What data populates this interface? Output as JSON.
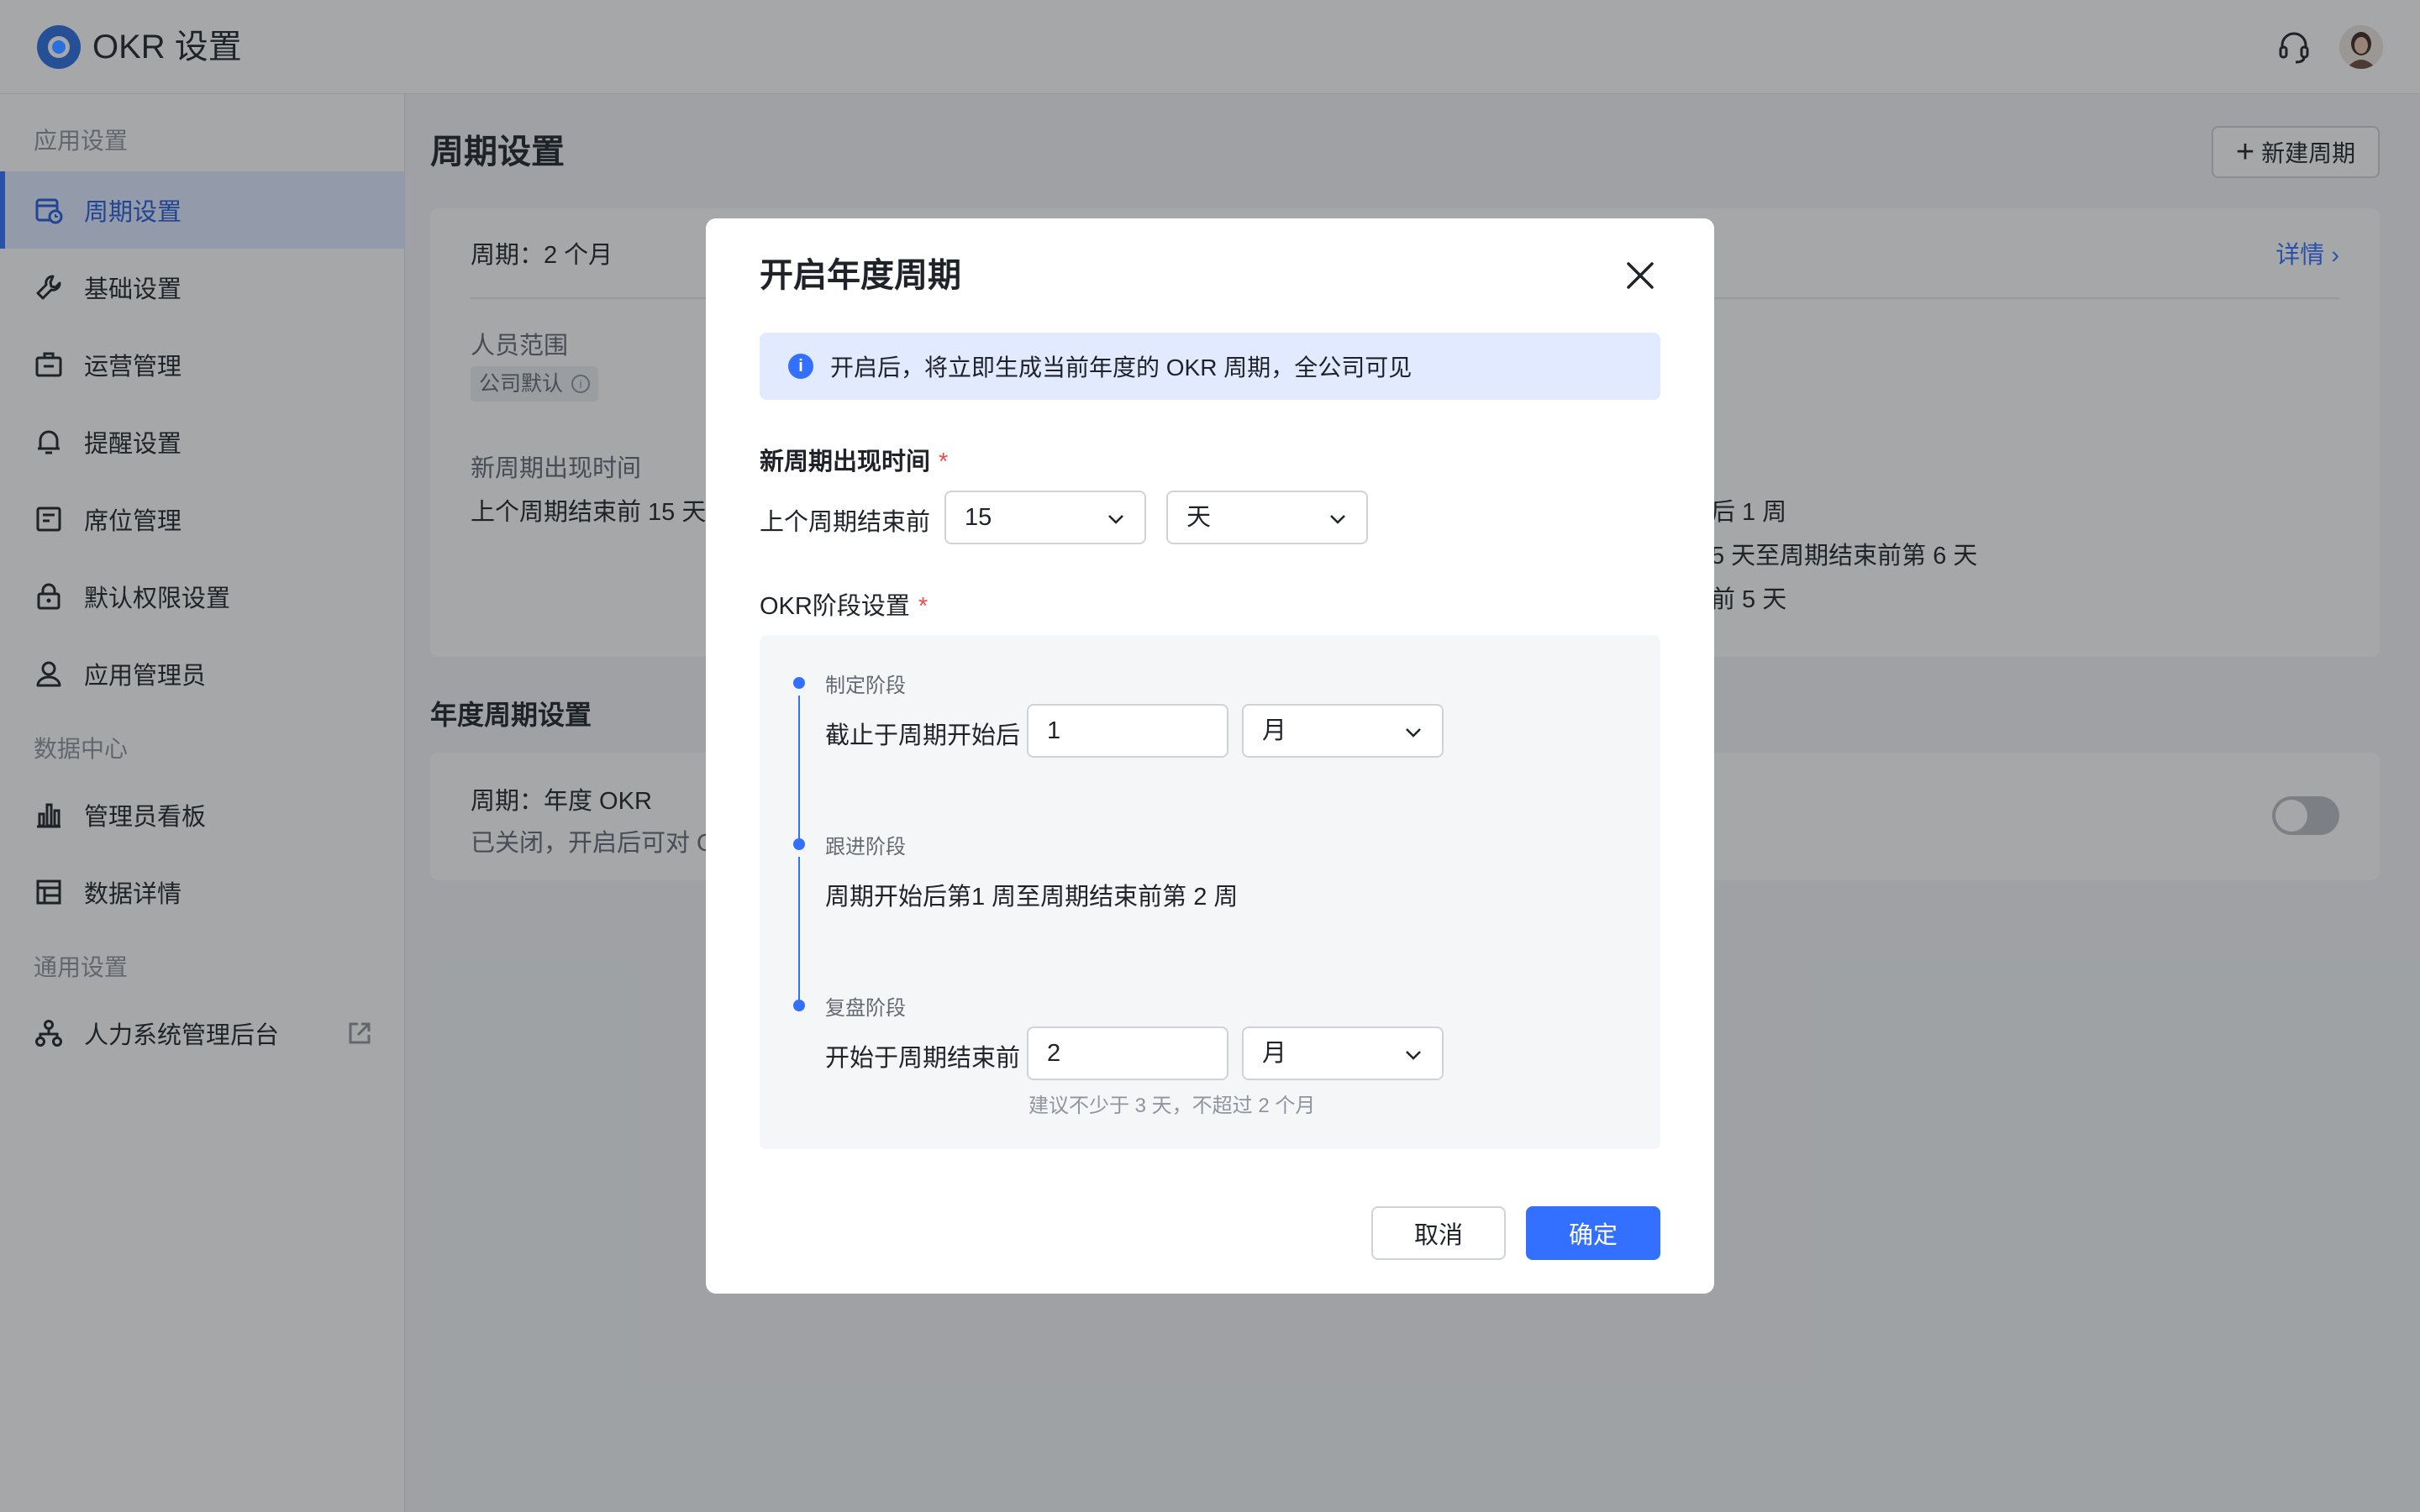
{
  "app": {
    "title": "OKR 设置"
  },
  "sidebar": {
    "groups": {
      "app_settings": "应用设置",
      "data_center": "数据中心",
      "general": "通用设置"
    },
    "items": [
      {
        "label": "周期设置",
        "icon": "calendar-icon",
        "active": true
      },
      {
        "label": "基础设置",
        "icon": "wrench-icon"
      },
      {
        "label": "运营管理",
        "icon": "briefcase-icon"
      },
      {
        "label": "提醒设置",
        "icon": "bell-icon"
      },
      {
        "label": "席位管理",
        "icon": "seat-icon"
      },
      {
        "label": "默认权限设置",
        "icon": "lock-icon"
      },
      {
        "label": "应用管理员",
        "icon": "person-icon"
      },
      {
        "label": "管理员看板",
        "icon": "bar-chart-icon"
      },
      {
        "label": "数据详情",
        "icon": "table-icon"
      },
      {
        "label": "人力系统管理后台",
        "icon": "org-icon",
        "external": true
      }
    ]
  },
  "main": {
    "title": "周期设置",
    "new_cycle_label": "新建周期",
    "card1": {
      "cycle": "周期：2 个月",
      "detail": "详情",
      "scope_label": "人员范围",
      "scope_tag": "公司默认",
      "appear_label": "新周期出现时间",
      "appear_value": "上个周期结束前 15 天",
      "right_line1": "后 1 周",
      "right_line2": "5 天至周期结束前第 6 天",
      "right_line3": "前 5 天"
    },
    "annual_title": "年度周期设置",
    "card2": {
      "cycle": "周期：年度 OKR",
      "desc": "已关闭，开启后可对 O"
    }
  },
  "modal": {
    "title": "开启年度周期",
    "alert": "开启后，将立即生成当前年度的 OKR 周期，全公司可见",
    "new_cycle_time_label": "新周期出现时间",
    "before_end_text": "上个周期结束前",
    "time_value": "15",
    "time_unit": "天",
    "stage_label": "OKR阶段设置",
    "stages": {
      "plan_name": "制定阶段",
      "plan_text": "截止于周期开始后",
      "plan_value": "1",
      "plan_unit": "月",
      "track_name": "跟进阶段",
      "track_text": "周期开始后第1 周至周期结束前第 2 周",
      "review_name": "复盘阶段",
      "review_text": "开始于周期结束前",
      "review_value": "2",
      "review_unit": "月",
      "review_hint": "建议不少于 3 天，不超过 2 个月"
    },
    "cancel": "取消",
    "confirm": "确定"
  },
  "colors": {
    "accent": "#3370ff",
    "required": "#f54a45"
  }
}
